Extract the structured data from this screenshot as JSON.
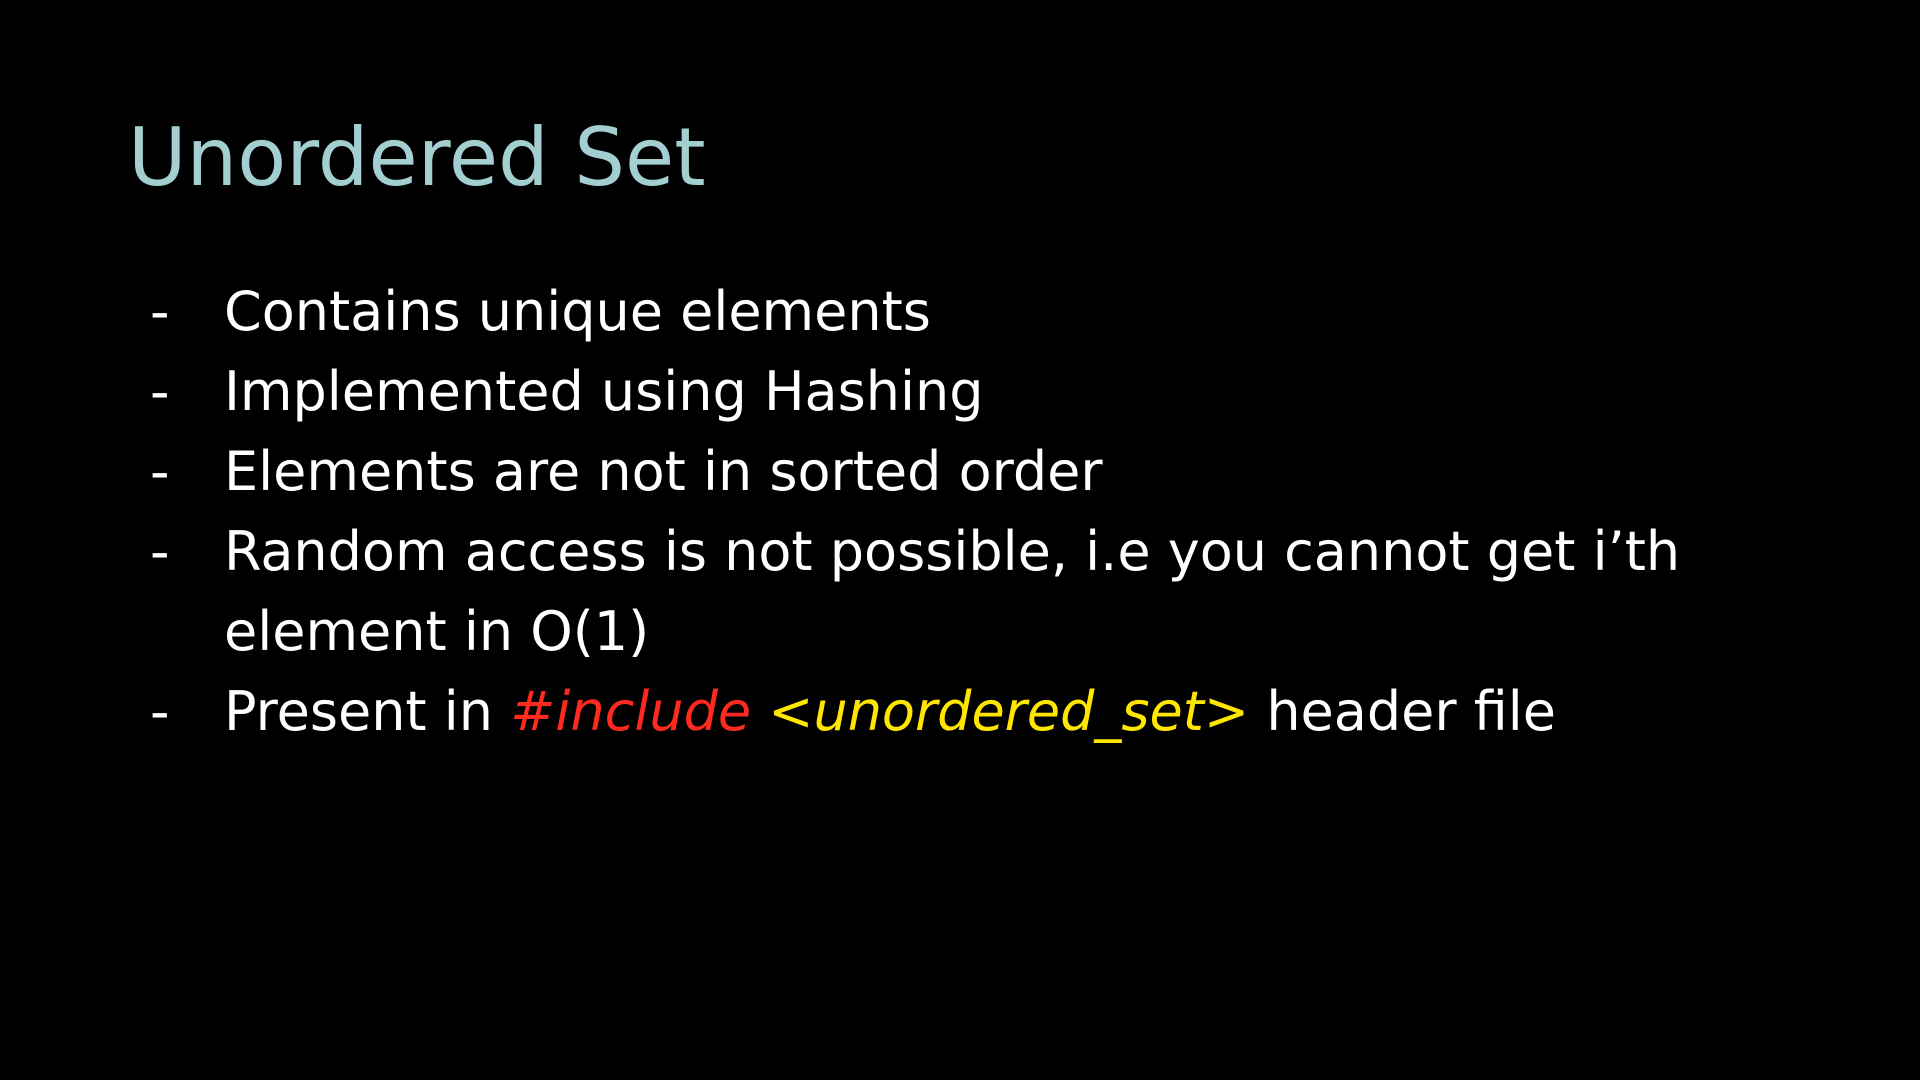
{
  "title": "Unordered Set",
  "colors": {
    "background": "#000000",
    "title": "#a3cfd0",
    "body_text": "#ffffff",
    "include_keyword": "#ff2a1f",
    "header_name": "#ffe600"
  },
  "bullet_marker": "-",
  "bullets": [
    {
      "text": "Contains unique elements"
    },
    {
      "text": "Implemented using Hashing"
    },
    {
      "text": "Elements are not in sorted order"
    },
    {
      "line1": "Random access is not possible, i.e you cannot get i’th",
      "line2": "element in O(1)"
    },
    {
      "prefix": "Present in ",
      "include": "#include",
      "header": "<unordered_set>",
      "suffix": " header file"
    }
  ]
}
